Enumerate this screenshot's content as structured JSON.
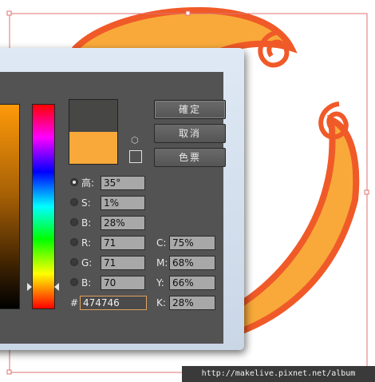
{
  "buttons": {
    "ok": "確定",
    "cancel": "取消",
    "swatches": "色票"
  },
  "hsb": {
    "h_label": "高:",
    "h_value": "35°",
    "s_label": "S:",
    "s_value": "1%",
    "b_label": "B:",
    "b_value": "28%"
  },
  "rgb": {
    "r_label": "R:",
    "r_value": "71",
    "g_label": "G:",
    "g_value": "71",
    "b_label": "B:",
    "b_value": "70"
  },
  "cmyk": {
    "c_label": "C:",
    "c_value": "75%",
    "m_label": "M:",
    "m_value": "68%",
    "y_label": "Y:",
    "y_value": "66%",
    "k_label": "K:",
    "k_value": "28%"
  },
  "hex": {
    "label": "#",
    "value": "474746"
  },
  "colors": {
    "new_color": "#474746",
    "original_color": "#f8a93a",
    "stroke": "#f05a28",
    "fill": "#f8a93a",
    "selection": "#e07070"
  },
  "watermark": "http://makelive.pixnet.net/album"
}
